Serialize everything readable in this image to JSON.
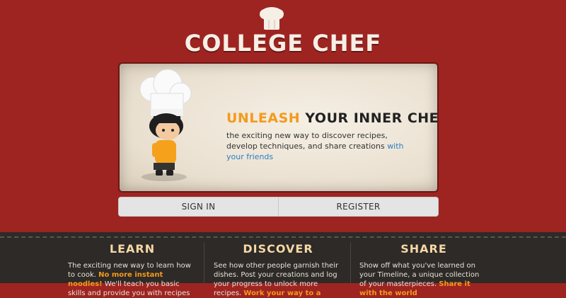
{
  "brand": {
    "title": "COLLEGE CHEF"
  },
  "hero": {
    "headline_accent": "UNLEASH",
    "headline_rest": " YOUR INNER CHEF",
    "desc_main": "the exciting new way to discover recipes, develop techniques, and share creations ",
    "desc_link": "with your friends"
  },
  "auth": {
    "sign_in": "SIGN IN",
    "register": "REGISTER"
  },
  "features": [
    {
      "title": "LEARN",
      "text_1": "The exciting new way to learn how to cook. ",
      "highlight": "No more instant noodles!",
      "text_2": " We'll teach you basic skills and provide you with recipes"
    },
    {
      "title": "DISCOVER",
      "text_1": "See how other people garnish their dishes. Post your creations and log your progress to unlock more recipes. ",
      "highlight": "Work your way to a",
      "text_2": ""
    },
    {
      "title": "SHARE",
      "text_1": "Show off what you've learned on your Timeline, a unique collection of your masterpieces. ",
      "highlight": "Share it with the world",
      "text_2": ""
    }
  ],
  "colors": {
    "brand_red": "#9e2421",
    "accent_orange": "#f39a1d",
    "link_blue": "#2a7fc5",
    "footer_dark": "#2d2a27"
  }
}
